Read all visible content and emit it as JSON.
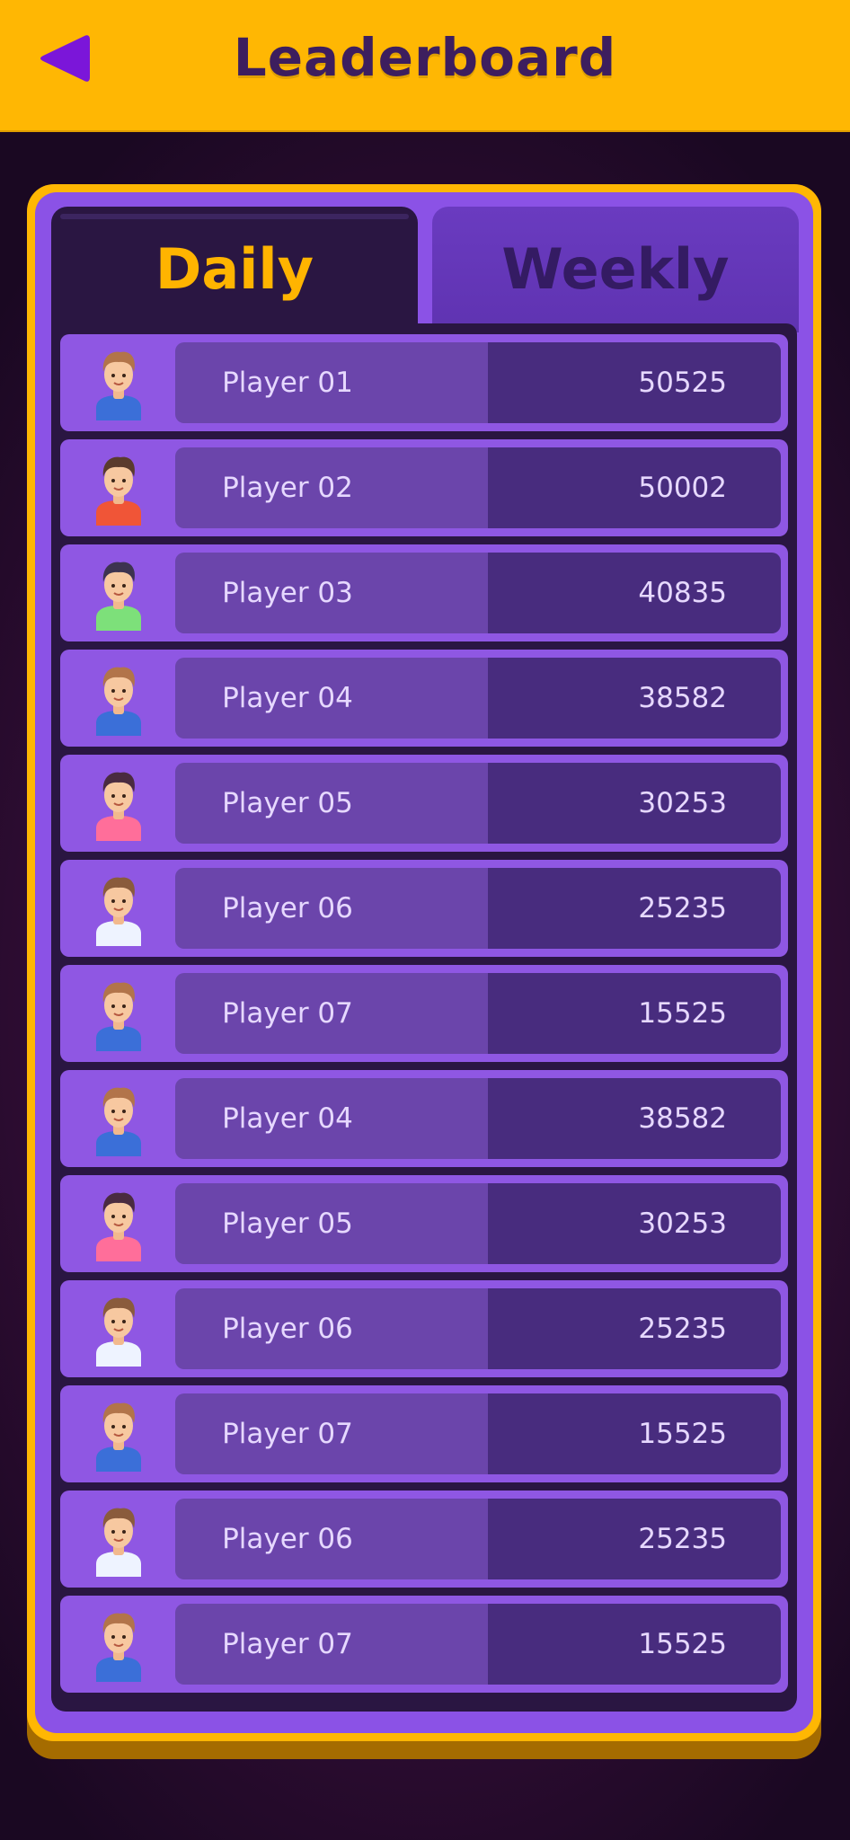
{
  "header": {
    "title": "Leaderboard",
    "back_icon": "back-arrow-icon",
    "bg_color": "#ffb703",
    "title_color": "#3d1e5e",
    "back_color": "#7b16d9"
  },
  "tabs": [
    {
      "label": "Daily",
      "active": true
    },
    {
      "label": "Weekly",
      "active": false
    }
  ],
  "rows": [
    {
      "name": "Player 01",
      "score": "50525",
      "avatar": "boy-jersey-10",
      "hair": "#b2744a",
      "shirt": "#3b6fd8"
    },
    {
      "name": "Player 02",
      "score": "50002",
      "avatar": "man-red-shirt",
      "hair": "#5a3b2d",
      "shirt": "#f05537"
    },
    {
      "name": "Player 03",
      "score": "40835",
      "avatar": "girl-green-shirt",
      "hair": "#3d3350",
      "shirt": "#7de07a"
    },
    {
      "name": "Player 04",
      "score": "38582",
      "avatar": "boy-jersey-10",
      "hair": "#b2744a",
      "shirt": "#3b6fd8"
    },
    {
      "name": "Player 05",
      "score": "30253",
      "avatar": "girl-pink-shirt",
      "hair": "#4a2b40",
      "shirt": "#ff6e9a"
    },
    {
      "name": "Player 06",
      "score": "25235",
      "avatar": "boy-white-shirt",
      "hair": "#8a5b3c",
      "shirt": "#eef3ff"
    },
    {
      "name": "Player 07",
      "score": "15525",
      "avatar": "boy-jersey-10",
      "hair": "#b2744a",
      "shirt": "#3b6fd8"
    },
    {
      "name": "Player 04",
      "score": "38582",
      "avatar": "boy-jersey-10",
      "hair": "#b2744a",
      "shirt": "#3b6fd8"
    },
    {
      "name": "Player 05",
      "score": "30253",
      "avatar": "girl-pink-shirt",
      "hair": "#4a2b40",
      "shirt": "#ff6e9a"
    },
    {
      "name": "Player 06",
      "score": "25235",
      "avatar": "boy-white-shirt",
      "hair": "#8a5b3c",
      "shirt": "#eef3ff"
    },
    {
      "name": "Player 07",
      "score": "15525",
      "avatar": "boy-jersey-10",
      "hair": "#b2744a",
      "shirt": "#3b6fd8"
    },
    {
      "name": "Player 06",
      "score": "25235",
      "avatar": "boy-white-shirt",
      "hair": "#8a5b3c",
      "shirt": "#eef3ff"
    },
    {
      "name": "Player 07",
      "score": "15525",
      "avatar": "boy-jersey-10",
      "hair": "#b2744a",
      "shirt": "#3b6fd8"
    }
  ]
}
